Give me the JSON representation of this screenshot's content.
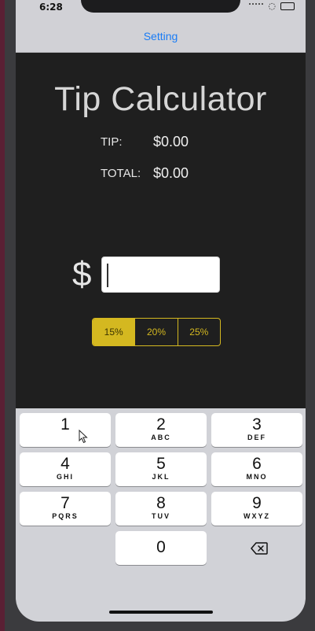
{
  "status_bar": {
    "time": "6:28"
  },
  "nav": {
    "setting_label": "Setting"
  },
  "main": {
    "title": "Tip Calculator",
    "tip_label": "TIP:",
    "tip_value": "$0.00",
    "total_label": "TOTAL:",
    "total_value": "$0.00",
    "currency_symbol": "$",
    "bill_amount": ""
  },
  "tip_options": {
    "items": [
      {
        "label": "15%"
      },
      {
        "label": "20%"
      },
      {
        "label": "25%"
      }
    ],
    "selected": "15%"
  },
  "keyboard": {
    "keys": [
      {
        "num": "1",
        "letters": ""
      },
      {
        "num": "2",
        "letters": "ABC"
      },
      {
        "num": "3",
        "letters": "DEF"
      },
      {
        "num": "4",
        "letters": "GHI"
      },
      {
        "num": "5",
        "letters": "JKL"
      },
      {
        "num": "6",
        "letters": "MNO"
      },
      {
        "num": "7",
        "letters": "PQRS"
      },
      {
        "num": "8",
        "letters": "TUV"
      },
      {
        "num": "9",
        "letters": "WXYZ"
      },
      {
        "num": "0",
        "letters": ""
      }
    ]
  },
  "colors": {
    "accent": "#d4b820",
    "link": "#1a7cf5",
    "background": "#1f1f1f"
  }
}
